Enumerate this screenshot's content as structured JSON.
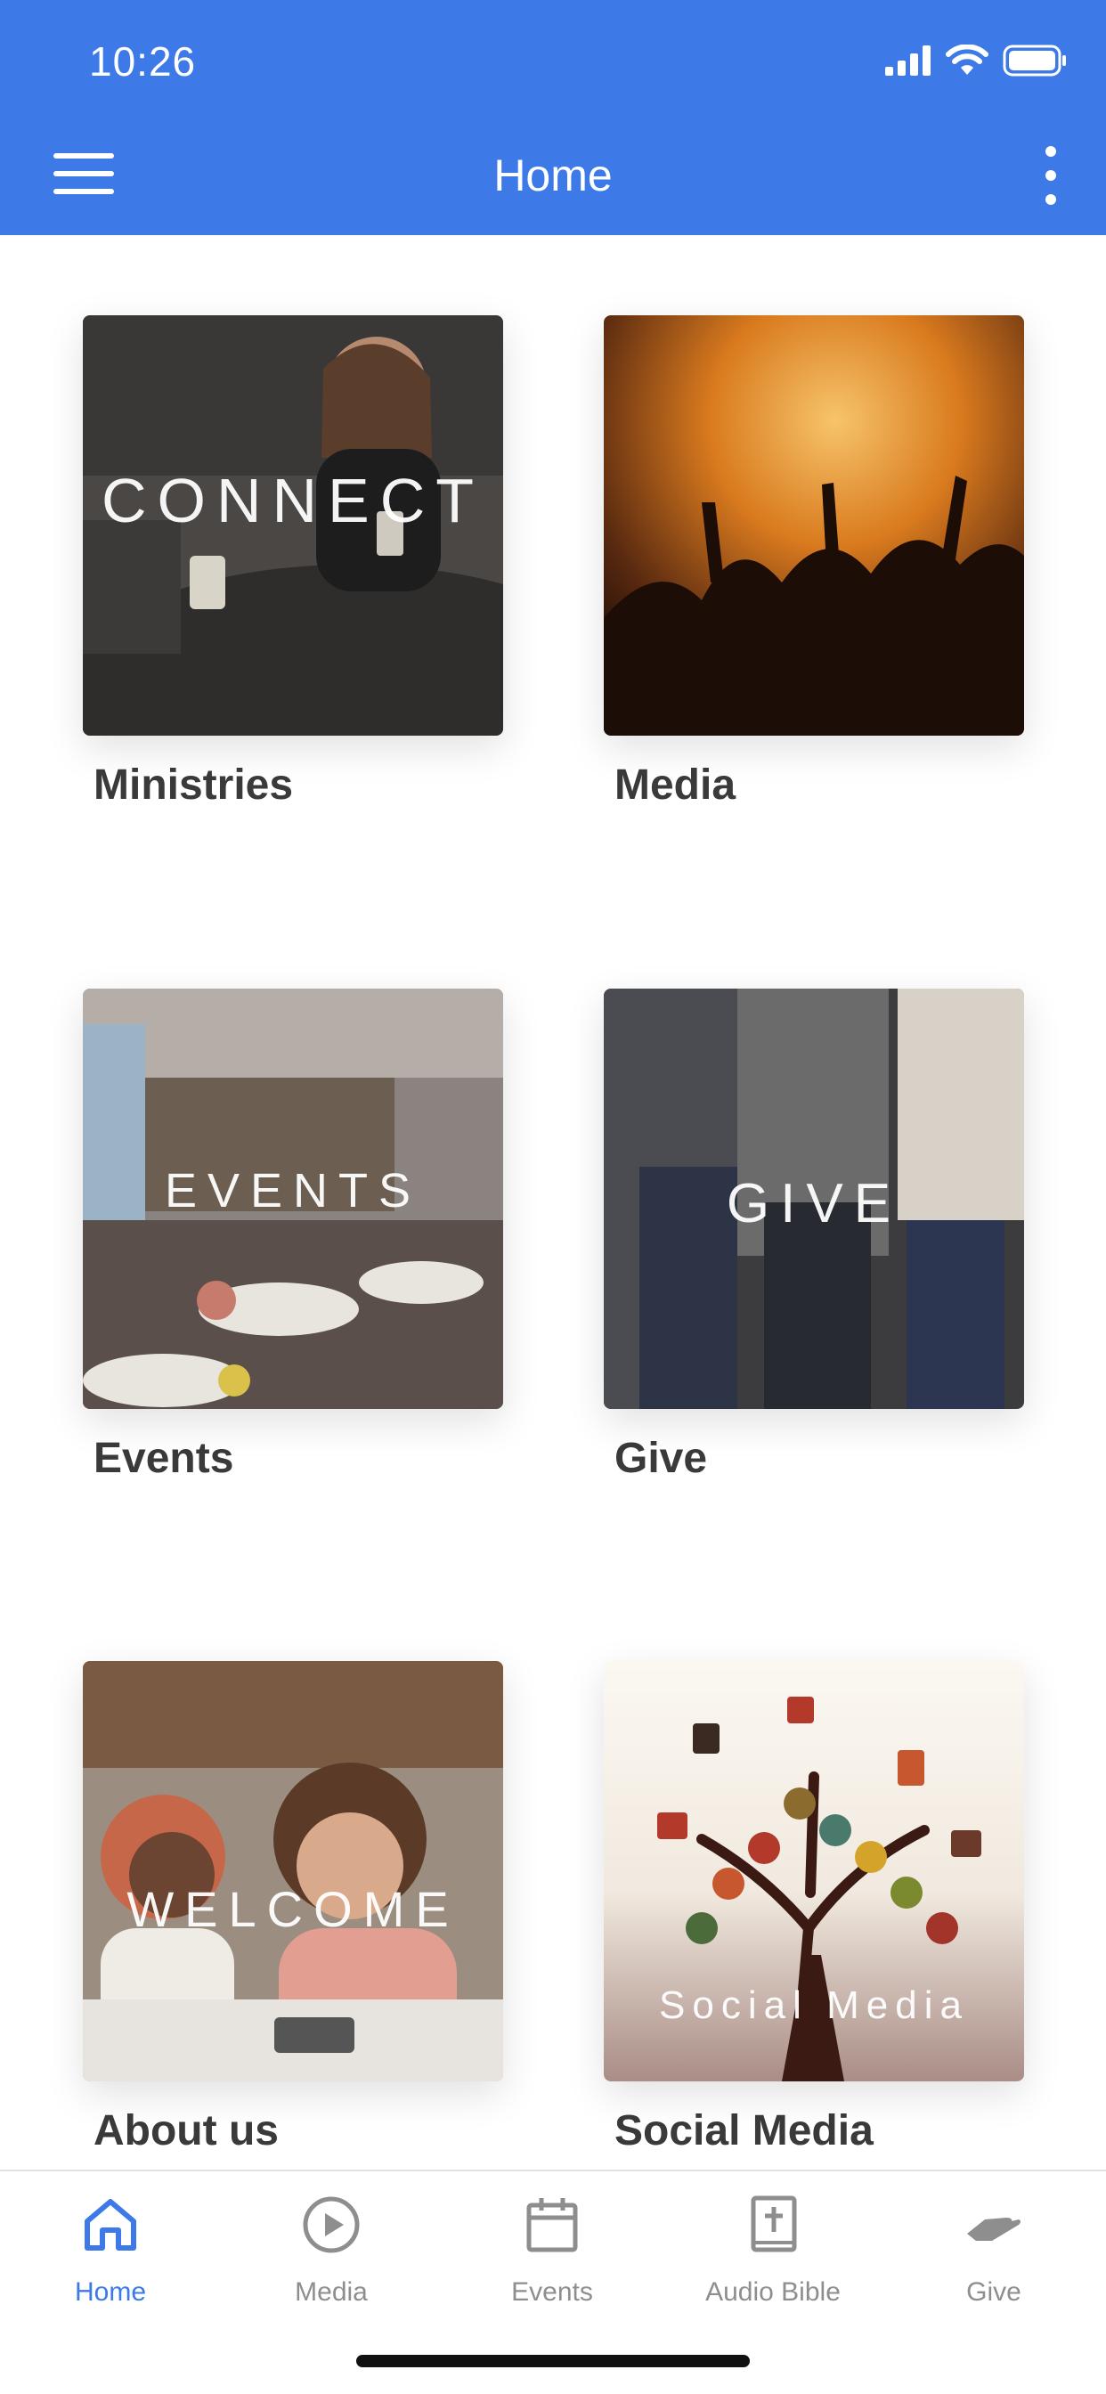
{
  "status_bar": {
    "time": "10:26"
  },
  "header": {
    "title": "Home",
    "background": "#3d7ae8"
  },
  "tiles": [
    {
      "label": "Ministries",
      "overlay": "CONNECT"
    },
    {
      "label": "Media",
      "overlay": ""
    },
    {
      "label": "Events",
      "overlay": "EVENTS"
    },
    {
      "label": "Give",
      "overlay": "GIVE"
    },
    {
      "label": "About us",
      "overlay": "WELCOME"
    },
    {
      "label": "Social Media",
      "overlay": "Social Media"
    }
  ],
  "tabbar": {
    "active": "Home",
    "active_color": "#3d7ae8",
    "items": [
      {
        "label": "Home",
        "icon": "home-icon"
      },
      {
        "label": "Media",
        "icon": "play-circle-icon"
      },
      {
        "label": "Events",
        "icon": "calendar-icon"
      },
      {
        "label": "Audio Bible",
        "icon": "bible-icon"
      },
      {
        "label": "Give",
        "icon": "give-hand-icon"
      }
    ]
  }
}
